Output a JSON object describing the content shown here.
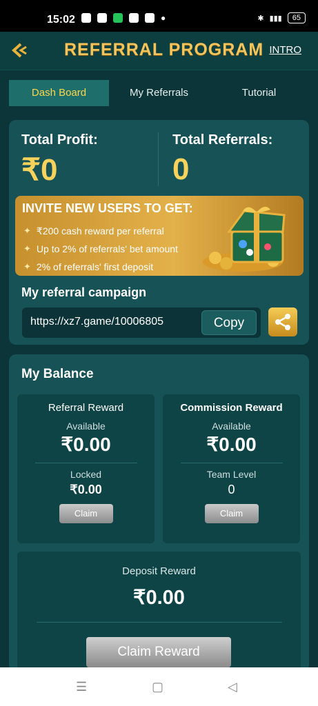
{
  "status": {
    "time": "15:02",
    "battery": "65"
  },
  "header": {
    "title": "REFERRAL PROGRAM",
    "intro": "INTRO"
  },
  "tabs": [
    {
      "label": "Dash Board"
    },
    {
      "label": "My Referrals"
    },
    {
      "label": "Tutorial"
    }
  ],
  "stats": {
    "profit_label": "Total Profit:",
    "profit_value": "₹0",
    "referrals_label": "Total Referrals:",
    "referrals_value": "0"
  },
  "invite": {
    "title": "INVITE NEW USERS TO GET:",
    "items": [
      "₹200 cash reward per referral",
      "Up to 2% of referrals' bet amount",
      "2% of referrals' first deposit"
    ]
  },
  "campaign": {
    "label": "My referral campaign",
    "link": "https://xz7.game/10006805",
    "copy": "Copy"
  },
  "balance": {
    "title": "My Balance",
    "referral": {
      "title": "Referral Reward",
      "available_label": "Available",
      "available": "₹0.00",
      "locked_label": "Locked",
      "locked": "₹0.00",
      "claim": "Claim"
    },
    "commission": {
      "title": "Commission Reward",
      "available_label": "Available",
      "available": "₹0.00",
      "team_label": "Team Level",
      "team": "0",
      "claim": "Claim"
    },
    "deposit": {
      "title": "Deposit Reward",
      "value": "₹0.00",
      "claim": "Claim Reward"
    }
  },
  "colors": {
    "accent": "#f8d35c",
    "tab_active": "#1e6e6c",
    "card": "#175256",
    "bg": "#0b3538"
  }
}
